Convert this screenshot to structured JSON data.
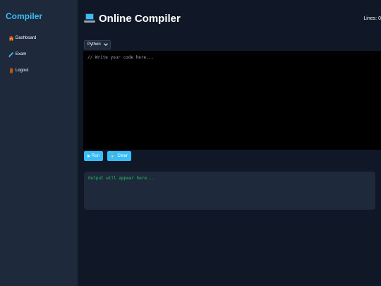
{
  "sidebar": {
    "brand": "Compiler",
    "items": [
      {
        "label": "Dashboard",
        "icon": "house-icon"
      },
      {
        "label": "Exam",
        "icon": "pencil-icon"
      },
      {
        "label": "Logout",
        "icon": "door-icon"
      }
    ]
  },
  "header": {
    "title": "Online Compiler",
    "lines_label": "Lines:",
    "lines_count": "0"
  },
  "editor": {
    "language": "Python",
    "placeholder": "// Write your code here...",
    "value": ""
  },
  "buttons": {
    "run_label": "Run",
    "clear_label": "Clear"
  },
  "output": {
    "text": "Output will appear here..."
  },
  "colors": {
    "accent": "#38bdf8",
    "sidebar_bg": "#1e293b",
    "main_bg": "#101827",
    "editor_bg": "#000000",
    "output_text": "#22c55e"
  }
}
